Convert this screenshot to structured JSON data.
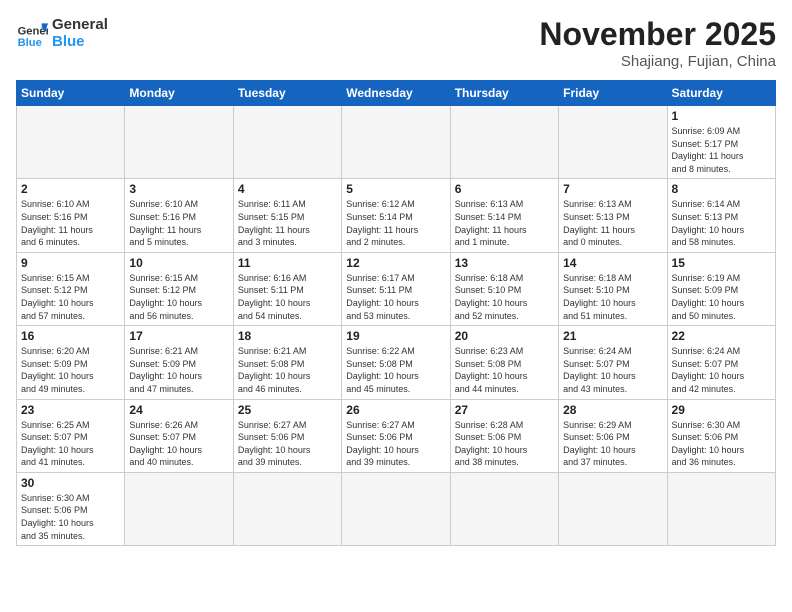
{
  "header": {
    "logo_general": "General",
    "logo_blue": "Blue",
    "month": "November 2025",
    "location": "Shajiang, Fujian, China"
  },
  "weekdays": [
    "Sunday",
    "Monday",
    "Tuesday",
    "Wednesday",
    "Thursday",
    "Friday",
    "Saturday"
  ],
  "weeks": [
    [
      {
        "day": "",
        "info": ""
      },
      {
        "day": "",
        "info": ""
      },
      {
        "day": "",
        "info": ""
      },
      {
        "day": "",
        "info": ""
      },
      {
        "day": "",
        "info": ""
      },
      {
        "day": "",
        "info": ""
      },
      {
        "day": "1",
        "info": "Sunrise: 6:09 AM\nSunset: 5:17 PM\nDaylight: 11 hours\nand 8 minutes."
      }
    ],
    [
      {
        "day": "2",
        "info": "Sunrise: 6:10 AM\nSunset: 5:16 PM\nDaylight: 11 hours\nand 6 minutes."
      },
      {
        "day": "3",
        "info": "Sunrise: 6:10 AM\nSunset: 5:16 PM\nDaylight: 11 hours\nand 5 minutes."
      },
      {
        "day": "4",
        "info": "Sunrise: 6:11 AM\nSunset: 5:15 PM\nDaylight: 11 hours\nand 3 minutes."
      },
      {
        "day": "5",
        "info": "Sunrise: 6:12 AM\nSunset: 5:14 PM\nDaylight: 11 hours\nand 2 minutes."
      },
      {
        "day": "6",
        "info": "Sunrise: 6:13 AM\nSunset: 5:14 PM\nDaylight: 11 hours\nand 1 minute."
      },
      {
        "day": "7",
        "info": "Sunrise: 6:13 AM\nSunset: 5:13 PM\nDaylight: 11 hours\nand 0 minutes."
      },
      {
        "day": "8",
        "info": "Sunrise: 6:14 AM\nSunset: 5:13 PM\nDaylight: 10 hours\nand 58 minutes."
      }
    ],
    [
      {
        "day": "9",
        "info": "Sunrise: 6:15 AM\nSunset: 5:12 PM\nDaylight: 10 hours\nand 57 minutes."
      },
      {
        "day": "10",
        "info": "Sunrise: 6:15 AM\nSunset: 5:12 PM\nDaylight: 10 hours\nand 56 minutes."
      },
      {
        "day": "11",
        "info": "Sunrise: 6:16 AM\nSunset: 5:11 PM\nDaylight: 10 hours\nand 54 minutes."
      },
      {
        "day": "12",
        "info": "Sunrise: 6:17 AM\nSunset: 5:11 PM\nDaylight: 10 hours\nand 53 minutes."
      },
      {
        "day": "13",
        "info": "Sunrise: 6:18 AM\nSunset: 5:10 PM\nDaylight: 10 hours\nand 52 minutes."
      },
      {
        "day": "14",
        "info": "Sunrise: 6:18 AM\nSunset: 5:10 PM\nDaylight: 10 hours\nand 51 minutes."
      },
      {
        "day": "15",
        "info": "Sunrise: 6:19 AM\nSunset: 5:09 PM\nDaylight: 10 hours\nand 50 minutes."
      }
    ],
    [
      {
        "day": "16",
        "info": "Sunrise: 6:20 AM\nSunset: 5:09 PM\nDaylight: 10 hours\nand 49 minutes."
      },
      {
        "day": "17",
        "info": "Sunrise: 6:21 AM\nSunset: 5:09 PM\nDaylight: 10 hours\nand 47 minutes."
      },
      {
        "day": "18",
        "info": "Sunrise: 6:21 AM\nSunset: 5:08 PM\nDaylight: 10 hours\nand 46 minutes."
      },
      {
        "day": "19",
        "info": "Sunrise: 6:22 AM\nSunset: 5:08 PM\nDaylight: 10 hours\nand 45 minutes."
      },
      {
        "day": "20",
        "info": "Sunrise: 6:23 AM\nSunset: 5:08 PM\nDaylight: 10 hours\nand 44 minutes."
      },
      {
        "day": "21",
        "info": "Sunrise: 6:24 AM\nSunset: 5:07 PM\nDaylight: 10 hours\nand 43 minutes."
      },
      {
        "day": "22",
        "info": "Sunrise: 6:24 AM\nSunset: 5:07 PM\nDaylight: 10 hours\nand 42 minutes."
      }
    ],
    [
      {
        "day": "23",
        "info": "Sunrise: 6:25 AM\nSunset: 5:07 PM\nDaylight: 10 hours\nand 41 minutes."
      },
      {
        "day": "24",
        "info": "Sunrise: 6:26 AM\nSunset: 5:07 PM\nDaylight: 10 hours\nand 40 minutes."
      },
      {
        "day": "25",
        "info": "Sunrise: 6:27 AM\nSunset: 5:06 PM\nDaylight: 10 hours\nand 39 minutes."
      },
      {
        "day": "26",
        "info": "Sunrise: 6:27 AM\nSunset: 5:06 PM\nDaylight: 10 hours\nand 39 minutes."
      },
      {
        "day": "27",
        "info": "Sunrise: 6:28 AM\nSunset: 5:06 PM\nDaylight: 10 hours\nand 38 minutes."
      },
      {
        "day": "28",
        "info": "Sunrise: 6:29 AM\nSunset: 5:06 PM\nDaylight: 10 hours\nand 37 minutes."
      },
      {
        "day": "29",
        "info": "Sunrise: 6:30 AM\nSunset: 5:06 PM\nDaylight: 10 hours\nand 36 minutes."
      }
    ],
    [
      {
        "day": "30",
        "info": "Sunrise: 6:30 AM\nSunset: 5:06 PM\nDaylight: 10 hours\nand 35 minutes."
      },
      {
        "day": "",
        "info": ""
      },
      {
        "day": "",
        "info": ""
      },
      {
        "day": "",
        "info": ""
      },
      {
        "day": "",
        "info": ""
      },
      {
        "day": "",
        "info": ""
      },
      {
        "day": "",
        "info": ""
      }
    ]
  ]
}
